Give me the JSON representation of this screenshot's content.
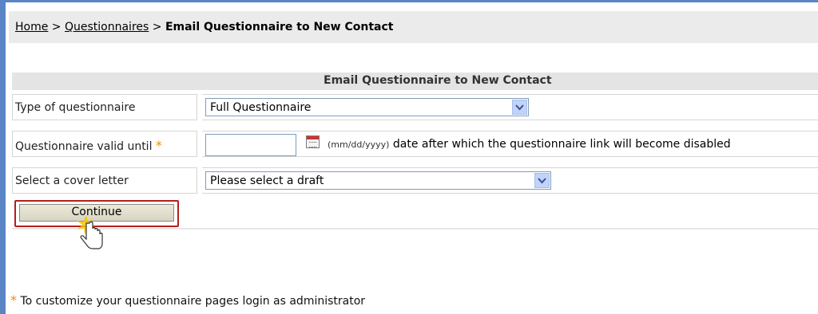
{
  "breadcrumb": {
    "home": "Home",
    "sep1": " > ",
    "questionnaires": "Questionnaires",
    "sep2": " > ",
    "current": "Email Questionnaire to New Contact"
  },
  "panel": {
    "title": "Email Questionnaire to New Contact"
  },
  "form": {
    "type_label": "Type of questionnaire",
    "type_value": "Full Questionnaire",
    "valid_label": "Questionnaire valid until",
    "valid_value": "",
    "date_format": "(mm/dd/yyyy)",
    "date_hint": " date after which the questionnaire link will become disabled",
    "cover_label": "Select a cover letter",
    "cover_value": "Please select a draft",
    "required_mark": "*"
  },
  "buttons": {
    "continue": "Continue"
  },
  "footer": {
    "mark": "*",
    "text": " To customize your questionnaire pages login as administrator"
  },
  "colors": {
    "required_star": "#f08a00",
    "highlight_outline": "#b41e1e",
    "accent_rule": "#5a85c4"
  }
}
